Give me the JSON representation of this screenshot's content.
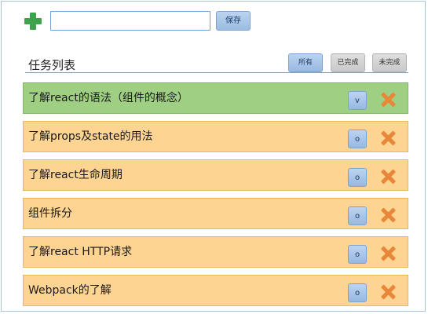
{
  "toolbar": {
    "add_icon": "plus-icon",
    "add_icon_color": "#3fa34d",
    "input_value": "",
    "input_placeholder": "",
    "save_label": "保存"
  },
  "list": {
    "title": "任务列表",
    "filters": {
      "all": "所有",
      "done": "已完成",
      "undone": "未完成",
      "active": "all"
    }
  },
  "colors": {
    "done_row": "#9fcf83",
    "pending_row": "#fdd491",
    "delete_icon": "#e8863a",
    "accent_button": "#9bbce3"
  },
  "tasks": [
    {
      "text": "了解react的语法（组件的概念）",
      "status": "done",
      "toggle_label": "v",
      "delete_icon": "close-icon"
    },
    {
      "text": "了解props及state的用法",
      "status": "pending",
      "toggle_label": "o",
      "delete_icon": "close-icon"
    },
    {
      "text": "了解react生命周期",
      "status": "pending",
      "toggle_label": "o",
      "delete_icon": "close-icon"
    },
    {
      "text": "组件拆分",
      "status": "pending",
      "toggle_label": "o",
      "delete_icon": "close-icon"
    },
    {
      "text": "了解react HTTP请求",
      "status": "pending",
      "toggle_label": "o",
      "delete_icon": "close-icon"
    },
    {
      "text": "Webpack的了解",
      "status": "pending",
      "toggle_label": "o",
      "delete_icon": "close-icon"
    }
  ]
}
